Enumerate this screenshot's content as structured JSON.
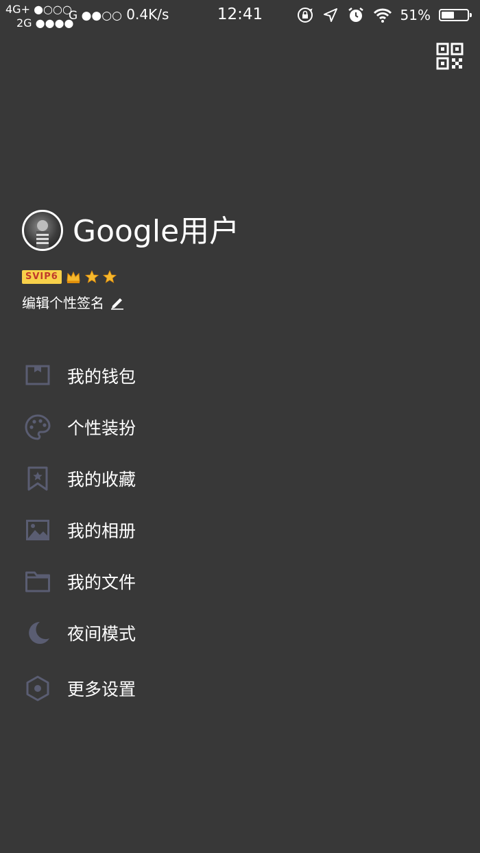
{
  "status_bar": {
    "carrier_line1": "4G+ ●○○○",
    "carrier_line2": "2G ●●●●",
    "carrier2_label": "G ●●○○",
    "net_speed": "0.4K/s",
    "time": "12:41",
    "battery_percent": "51%",
    "battery_level": 0.51,
    "icons": [
      "rotation-lock-icon",
      "location-icon",
      "alarm-icon",
      "wifi-icon",
      "battery-icon"
    ]
  },
  "header": {
    "qr_icon": "qr-code-icon"
  },
  "profile": {
    "username": "Google用户",
    "vip_badge": "SVIP6",
    "signature_label": "编辑个性签名",
    "badge_icons": [
      "crown-icon",
      "star-icon",
      "star-icon"
    ]
  },
  "menu": {
    "items": [
      {
        "label": "我的钱包",
        "icon": "wallet-icon"
      },
      {
        "label": "个性装扮",
        "icon": "palette-icon"
      },
      {
        "label": "我的收藏",
        "icon": "bookmark-icon"
      },
      {
        "label": "我的相册",
        "icon": "image-icon"
      },
      {
        "label": "我的文件",
        "icon": "folder-icon"
      },
      {
        "label": "夜间模式",
        "icon": "moon-icon"
      },
      {
        "label": "更多设置",
        "icon": "settings-icon"
      }
    ]
  },
  "colors": {
    "background": "#383838",
    "icon": "#5a5d72",
    "text": "#ffffff",
    "vip_badge_bg": "#f7d04a",
    "vip_badge_text": "#c0392b",
    "star": "#f5b82e"
  }
}
